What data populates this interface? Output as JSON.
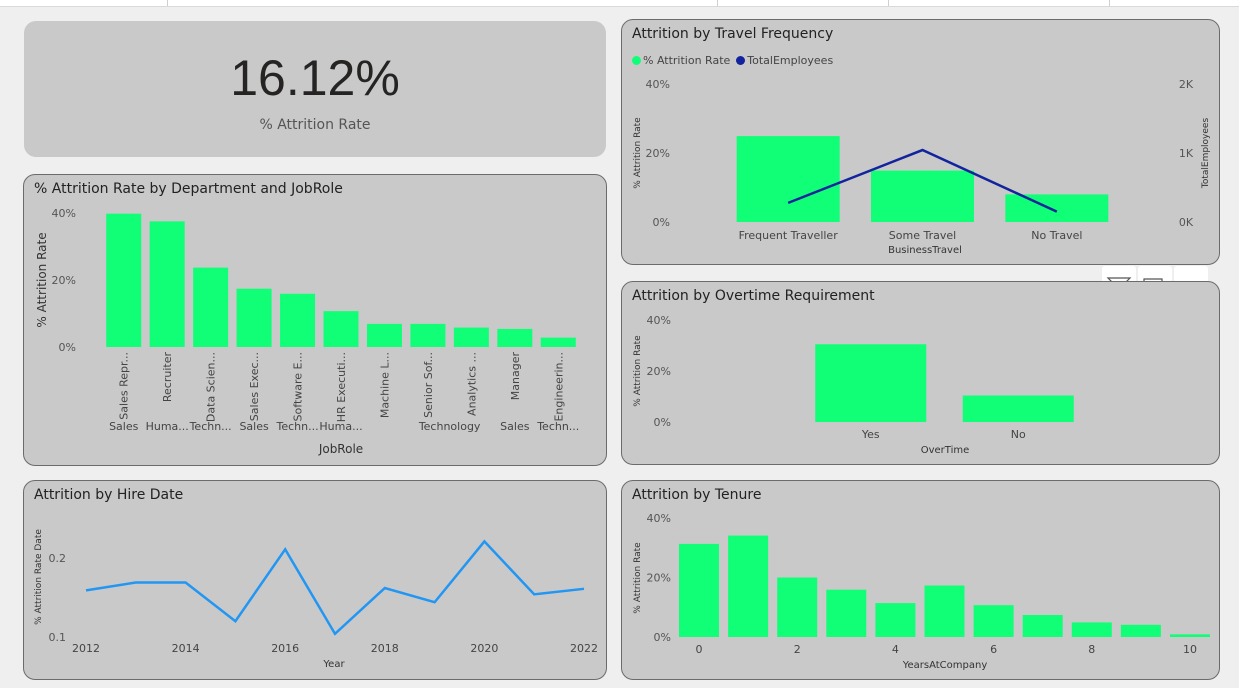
{
  "kpi": {
    "value": "16.12%",
    "label": "% Attrition Rate"
  },
  "colors": {
    "bar": "#11ff77",
    "line_navy": "#12239e",
    "line_blue": "#2196f3",
    "card": "#c9c9c9"
  },
  "travel": {
    "title": "Attrition by Travel Frequency",
    "legend": [
      "% Attrition Rate",
      "TotalEmployees"
    ],
    "chart_data": {
      "type": "bar",
      "title": "Attrition by Travel Frequency",
      "categories": [
        "Frequent Traveller",
        "Some Travel",
        "No Travel"
      ],
      "series": [
        {
          "name": "% Attrition Rate",
          "type": "bar",
          "values": [
            24.9,
            14.9,
            8.0
          ]
        },
        {
          "name": "TotalEmployees",
          "type": "line",
          "axis": "right",
          "values": [
            277,
            1043,
            150
          ]
        }
      ],
      "xlabel": "BusinessTravel",
      "ylabel": "% Attrition Rate",
      "y2label": "TotalEmployees",
      "ylim": [
        0,
        40
      ],
      "y2lim": [
        0,
        2000
      ],
      "yticks": [
        "0%",
        "20%",
        "40%"
      ],
      "y2ticks": [
        "0K",
        "1K",
        "2K"
      ]
    }
  },
  "department": {
    "title": "% Attrition Rate by Department and JobRole",
    "chart_data": {
      "type": "bar",
      "title": "% Attrition Rate by Department and JobRole",
      "categories": [
        "Sales Repr...",
        "Recruiter",
        "Data Scien...",
        "Sales Exec...",
        "Software E...",
        "HR Executi...",
        "Machine L...",
        "Senior Sof...",
        "Analytics ...",
        "Manager",
        "Engineerin..."
      ],
      "groups": [
        "Sales",
        "Huma...",
        "Techn...",
        "Sales",
        "Techn...",
        "Huma...",
        "",
        "Technology",
        "",
        "Sales",
        "Techn..."
      ],
      "values": [
        39.8,
        37.5,
        23.7,
        17.4,
        15.9,
        10.7,
        6.9,
        6.9,
        5.8,
        5.4,
        2.8
      ],
      "xlabel": "JobRole",
      "ylabel": "% Attrition Rate",
      "ylim": [
        0,
        40
      ],
      "yticks": [
        "0%",
        "20%",
        "40%"
      ]
    }
  },
  "overtime": {
    "title": "Attrition by Overtime Requirement",
    "chart_data": {
      "type": "bar",
      "title": "Attrition by Overtime Requirement",
      "categories": [
        "Yes",
        "No"
      ],
      "values": [
        30.5,
        10.4
      ],
      "xlabel": "OverTime",
      "ylabel": "% Attrition Rate",
      "ylim": [
        0,
        40
      ],
      "yticks": [
        "0%",
        "20%",
        "40%"
      ]
    }
  },
  "hire": {
    "title": "Attrition by Hire Date",
    "chart_data": {
      "type": "line",
      "title": "Attrition by Hire Date",
      "x": [
        2012,
        2013,
        2014,
        2015,
        2016,
        2017,
        2018,
        2019,
        2020,
        2021,
        2022
      ],
      "values": [
        0.159,
        0.169,
        0.169,
        0.12,
        0.211,
        0.104,
        0.162,
        0.144,
        0.221,
        0.154,
        0.161
      ],
      "xticks": [
        "2012",
        "2014",
        "2016",
        "2018",
        "2020",
        "2022"
      ],
      "xlabel": "Year",
      "ylabel": "% Attrition Rate Date",
      "ylim": [
        0.1,
        0.25
      ],
      "yticks": [
        "0.1",
        "0.2"
      ]
    }
  },
  "tenure": {
    "title": "Attrition by Tenure",
    "chart_data": {
      "type": "bar",
      "title": "Attrition by Tenure",
      "x": [
        0,
        1,
        2,
        3,
        4,
        5,
        6,
        7,
        8,
        9,
        10
      ],
      "values": [
        31.3,
        34.1,
        20.0,
        15.9,
        11.4,
        17.3,
        10.7,
        7.4,
        4.9,
        4.1,
        0.9
      ],
      "xticks": [
        "0",
        "2",
        "4",
        "6",
        "8",
        "10"
      ],
      "xlabel": "YearsAtCompany",
      "ylabel": "% Attrition Rate",
      "ylim": [
        0,
        40
      ],
      "yticks": [
        "0%",
        "20%",
        "40%"
      ]
    }
  }
}
